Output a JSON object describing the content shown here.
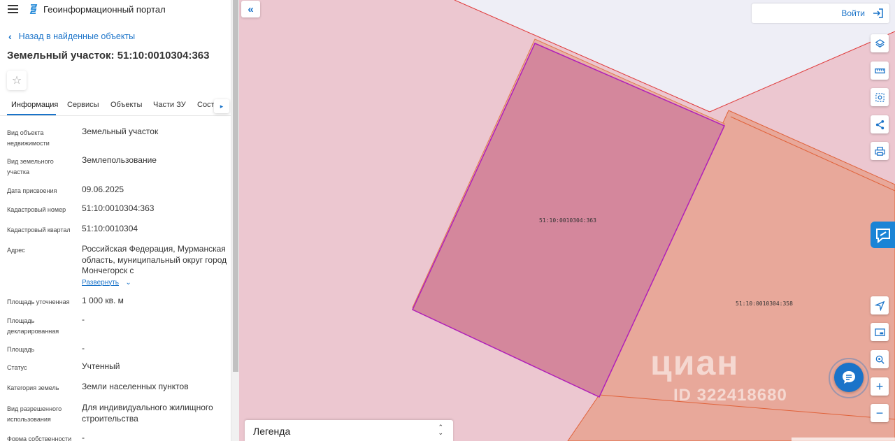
{
  "header": {
    "portal_title": "Геоинформационный портал"
  },
  "panel": {
    "back_label": "Назад в найденные объекты",
    "object_title": "Земельный участок: 51:10:0010304:363",
    "tabs": [
      {
        "label": "Информация"
      },
      {
        "label": "Сервисы"
      },
      {
        "label": "Объекты"
      },
      {
        "label": "Части ЗУ"
      },
      {
        "label": "Соста"
      }
    ],
    "expand_label": "Развернуть",
    "rows": [
      {
        "label": "Вид объекта недвижимости",
        "value": "Земельный участок"
      },
      {
        "label": "Вид земельного участка",
        "value": "Землепользование"
      },
      {
        "label": "Дата присвоения",
        "value": "09.06.2025"
      },
      {
        "label": "Кадастровый номер",
        "value": "51:10:0010304:363"
      },
      {
        "label": "Кадастровый квартал",
        "value": "51:10:0010304"
      },
      {
        "label": "Адрес",
        "value": "Российская Федерация, Мурманская область, муниципальный округ город Мончегорск с"
      },
      {
        "label": "Площадь уточненная",
        "value": "1 000 кв. м"
      },
      {
        "label": "Площадь декларированная",
        "value": "-"
      },
      {
        "label": "Площадь",
        "value": "-"
      },
      {
        "label": "Статус",
        "value": "Учтенный"
      },
      {
        "label": "Категория земель",
        "value": "Земли населенных пунктов"
      },
      {
        "label": "Вид разрешенного использования",
        "value": "Для индивидуального жилищного строительства"
      },
      {
        "label": "Форма собственности",
        "value": "-"
      }
    ]
  },
  "map": {
    "login_label": "Войти",
    "legend_label": "Легенда",
    "parcels": [
      {
        "cadastral_number": "51:10:0010304:363"
      },
      {
        "cadastral_number": "51:10:0010304:358"
      }
    ],
    "watermark": {
      "brand": "циан",
      "id": "ID 322418680"
    }
  },
  "colors": {
    "accent": "#1a73c9",
    "selected_parcel_fill": "#d4879c",
    "selected_parcel_stroke": "#b020b8",
    "neighbor_parcel_fill": "#e8a89a",
    "map_background": "#ecc7d0",
    "border_lines": "#e03a3a"
  },
  "icons": {
    "menu": "hamburger-icon",
    "logo": "portal-logo-icon",
    "back": "chevron-left-icon",
    "favorite": "star-outline-icon",
    "tabs_next": "chevron-right-icon",
    "collapse": "double-chevron-left-icon",
    "login": "sign-in-icon",
    "layers": "layers-icon",
    "ruler": "ruler-icon",
    "select_area": "select-area-icon",
    "share": "share-icon",
    "print": "print-icon",
    "side_panel": "chat-bubble-icon",
    "geolocation": "navigation-arrow-icon",
    "minimap": "minimap-icon",
    "place_search": "map-pin-search-icon",
    "zoom_in": "plus-icon",
    "zoom_out": "minus-icon",
    "chat": "message-icon"
  }
}
